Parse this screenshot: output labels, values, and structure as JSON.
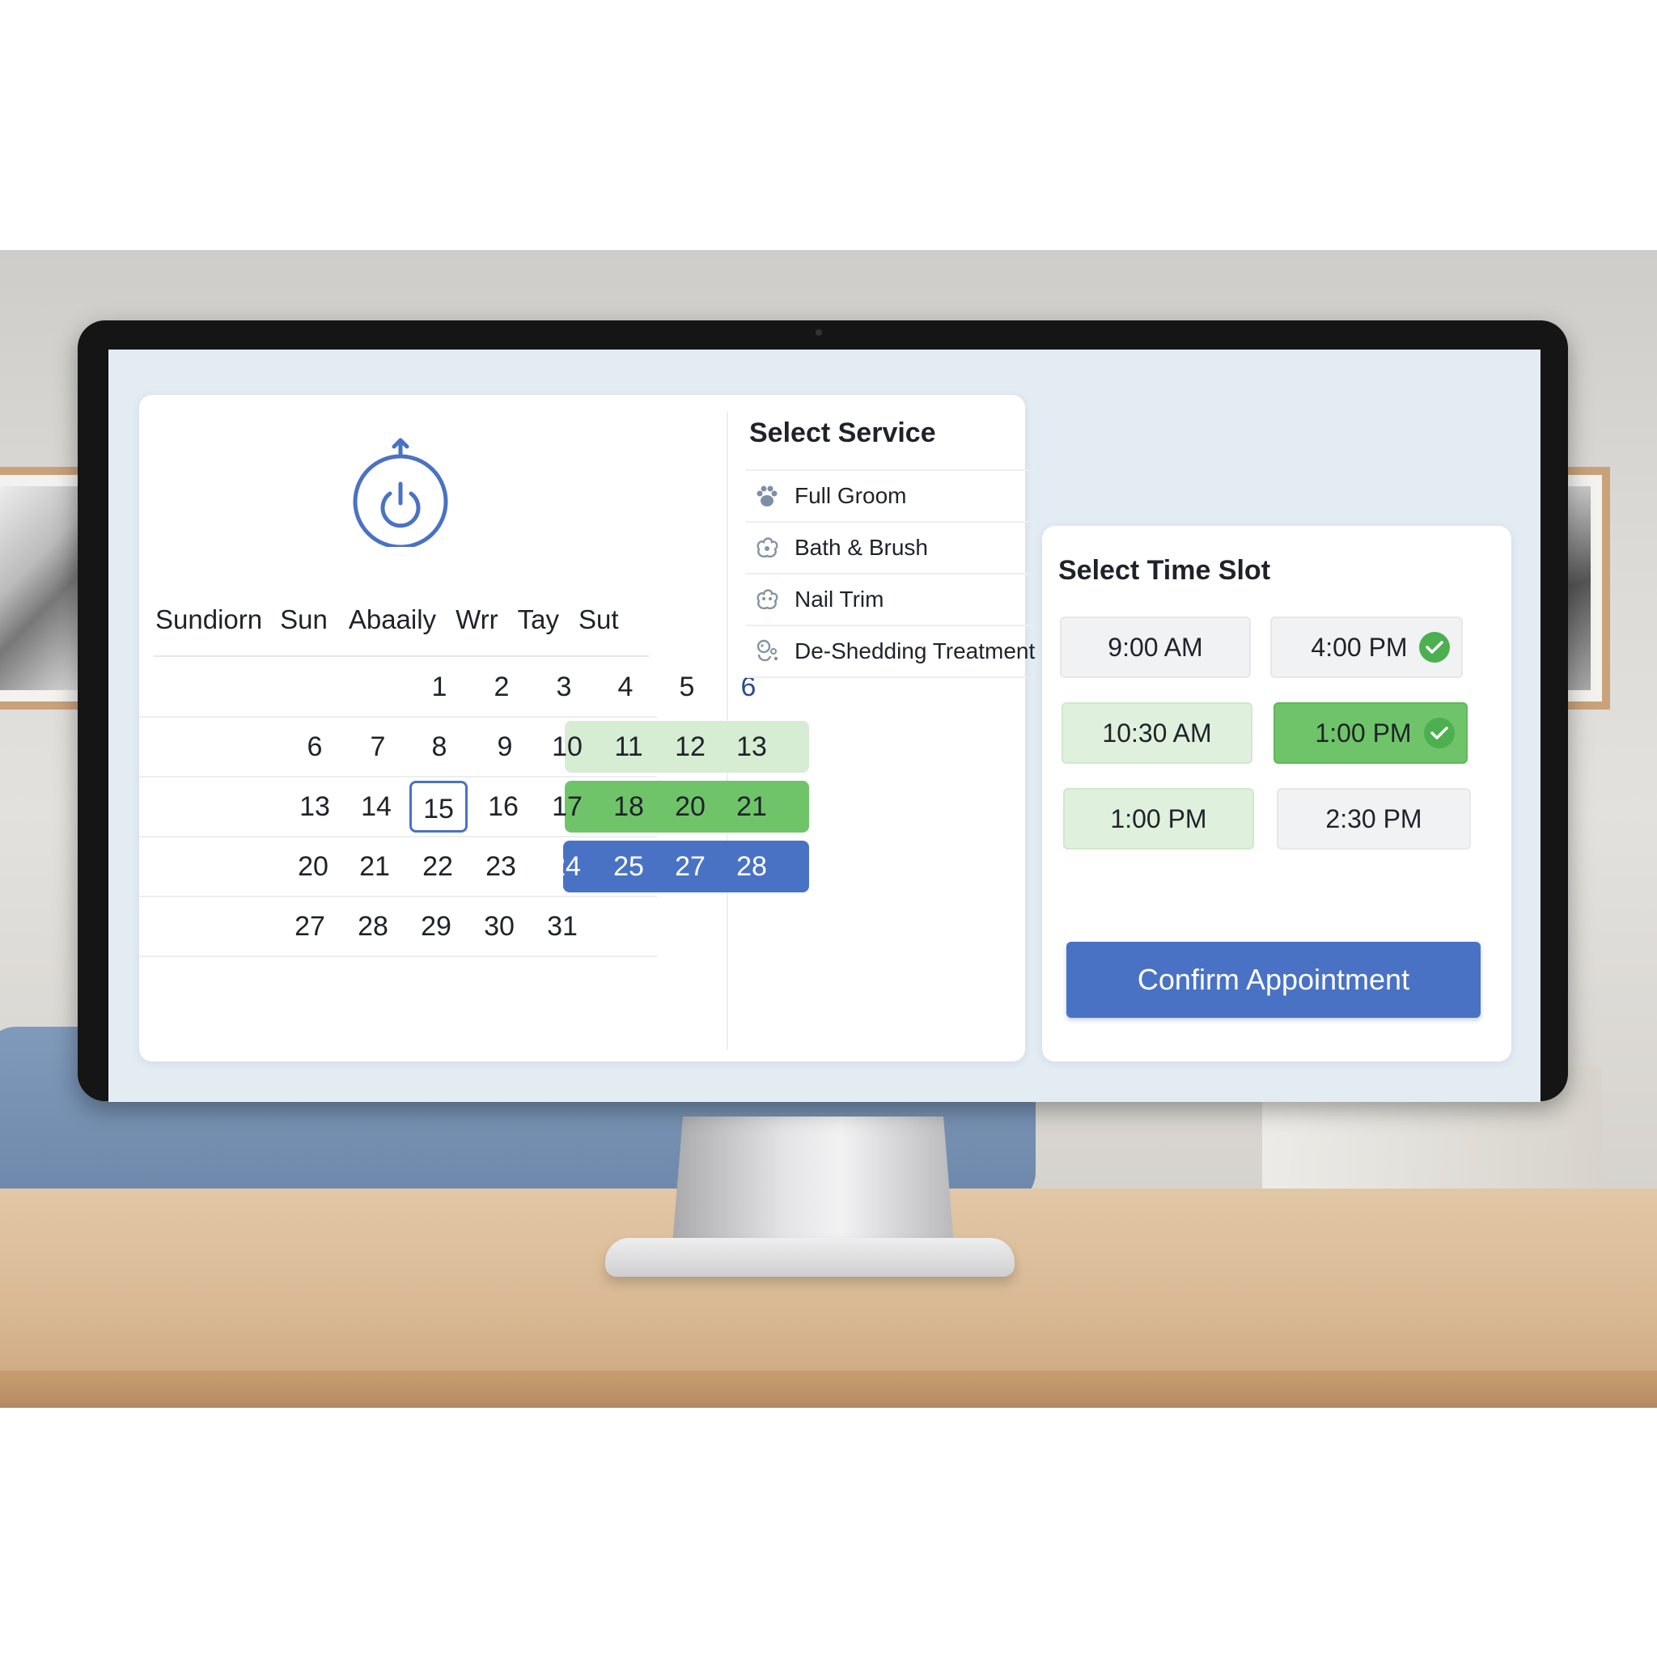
{
  "calendar": {
    "weekday_headers": [
      "Sundiorn",
      "Sun",
      "Abaaily",
      "Wrr",
      "Tay",
      "Sut"
    ],
    "weeks": [
      [
        "",
        "",
        "1",
        "2",
        "3",
        "4",
        "5",
        "6"
      ],
      [
        "6",
        "7",
        "8",
        "9",
        "10",
        "11",
        "12",
        "13"
      ],
      [
        "13",
        "14",
        "15",
        "16",
        "17",
        "18",
        "20",
        "21"
      ],
      [
        "20",
        "21",
        "22",
        "23",
        "24",
        "25",
        "27",
        "28"
      ],
      [
        "27",
        "28",
        "29",
        "30",
        "31",
        "",
        "",
        ""
      ]
    ],
    "today": "15"
  },
  "services": {
    "title": "Select Service",
    "items": [
      {
        "label": "Full Groom",
        "icon": "paw-icon"
      },
      {
        "label": "Bath & Brush",
        "icon": "bath-icon"
      },
      {
        "label": "Nail Trim",
        "icon": "nail-icon"
      },
      {
        "label": "De-Shedding Treatment",
        "icon": "shedding-icon"
      }
    ]
  },
  "time_slots": {
    "title": "Select Time Slot",
    "slots": [
      {
        "label": "9:00 AM",
        "state": "available"
      },
      {
        "label": "4:00 PM",
        "state": "checked"
      },
      {
        "label": "10:30 AM",
        "state": "highlighted"
      },
      {
        "label": "1:00 PM",
        "state": "selected"
      },
      {
        "label": "1:00 PM",
        "state": "highlighted"
      },
      {
        "label": "2:30 PM",
        "state": "available"
      }
    ]
  },
  "confirm_label": "Confirm Appointment",
  "colors": {
    "accent_blue": "#4a72c4",
    "green_selected": "#6fc46a",
    "green_light": "#dff1dc",
    "check_green": "#4caf50"
  }
}
